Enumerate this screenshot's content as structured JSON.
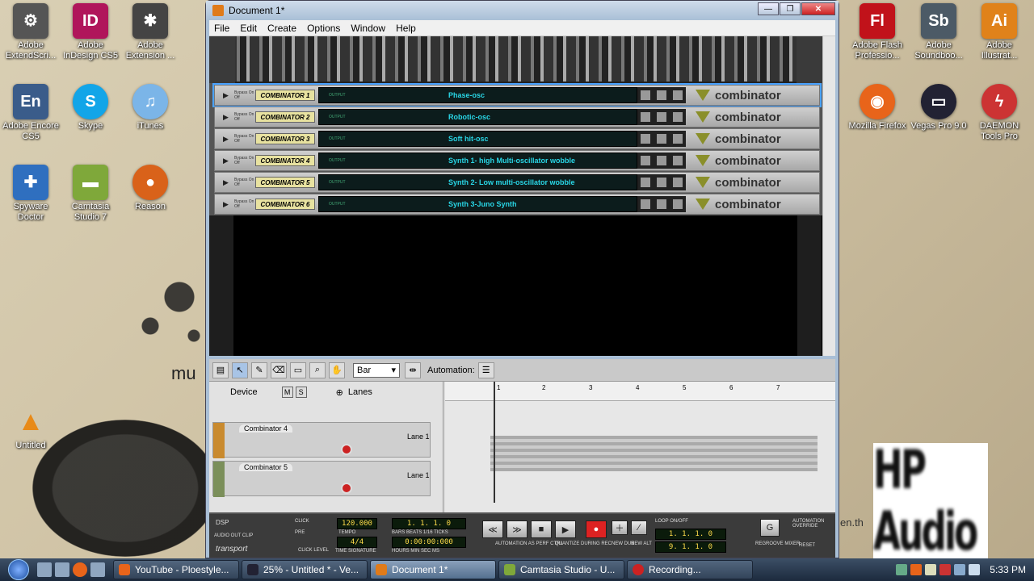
{
  "desktop": {
    "icons_left": [
      {
        "label": "Adobe ExtendScri...",
        "color": "#555"
      },
      {
        "label": "Adobe InDesign CS5",
        "color": "#b0155b",
        "glyph": "ID"
      },
      {
        "label": "Adobe Extension ...",
        "color": "#444"
      },
      {
        "label": "Adobe Encore CS5",
        "color": "#3a5c8a",
        "glyph": "En"
      },
      {
        "label": "Skype",
        "color": "#12a5e8",
        "glyph": "S"
      },
      {
        "label": "iTunes",
        "color": "#7bb5e8",
        "glyph": "♫"
      },
      {
        "label": "Spyware Doctor",
        "color": "#2f6fbf"
      },
      {
        "label": "Camtasia Studio 7",
        "color": "#7fa83a"
      },
      {
        "label": "Reason",
        "color": "#d9621a"
      },
      {
        "label": "Untitled",
        "color": "#e88a18",
        "glyph": "▲"
      }
    ],
    "icons_right": [
      {
        "label": "Adobe Flash Professio...",
        "color": "#c1121a",
        "glyph": "Fl"
      },
      {
        "label": "Adobe Soundboo...",
        "color": "#4c5a66",
        "glyph": "Sb"
      },
      {
        "label": "Adobe Illustrat...",
        "color": "#e0821a",
        "glyph": "Ai"
      },
      {
        "label": "Mozilla Firefox",
        "color": "#e8641a"
      },
      {
        "label": "Vegas Pro 9.0",
        "color": "#223"
      },
      {
        "label": "DAEMON Tools Pro",
        "color": "#c33"
      }
    ],
    "bg_text": "mu",
    "bg_text2": "en.th",
    "logo_text": "HP Audio"
  },
  "window": {
    "title": "Document 1*",
    "menu": [
      "File",
      "Edit",
      "Create",
      "Options",
      "Window",
      "Help"
    ]
  },
  "rack": {
    "combinators": [
      {
        "name": "COMBINATOR 1",
        "patch": "Phase-osc",
        "brand": "combinator"
      },
      {
        "name": "COMBINATOR 2",
        "patch": "Robotic-osc",
        "brand": "combinator"
      },
      {
        "name": "COMBINATOR 3",
        "patch": "Soft hit-osc",
        "brand": "combinator"
      },
      {
        "name": "COMBINATOR 4",
        "patch": "Synth 1- high Multi-oscillator wobble",
        "brand": "combinator"
      },
      {
        "name": "COMBINATOR 5",
        "patch": "Synth 2- Low multi-oscillator wobble",
        "brand": "combinator"
      },
      {
        "name": "COMBINATOR 6",
        "patch": "Synth 3-Juno Synth",
        "brand": "combinator"
      }
    ],
    "bypass_text": "Bypass On Off",
    "mini_text": "OUTPUT"
  },
  "sequencer": {
    "snap": "Bar",
    "automation_label": "Automation:",
    "col_device": "Device",
    "col_lanes": "Lanes",
    "m_label": "M",
    "s_label": "S",
    "tracks": [
      {
        "name": "Combinator 4",
        "lane": "Lane 1",
        "color": "#c98a2e"
      },
      {
        "name": "Combinator 5",
        "lane": "Lane 1",
        "color": "#7b8f5a"
      }
    ],
    "ruler": [
      "1",
      "2",
      "3",
      "4",
      "5",
      "6",
      "7"
    ]
  },
  "transport": {
    "dsp": "DSP",
    "audio_out_clip": "AUDIO OUT CLIP",
    "brand": "transport",
    "click": "CLICK",
    "pre": "PRE",
    "click_level": "CLICK LEVEL",
    "tempo": "120.000",
    "tempo_label": "TEMPO",
    "sig": "4/4",
    "sig_label": "TIME SIGNATURE",
    "position": "1. 1. 1. 0",
    "position_label": "BARS BEATS 1/16 TICKS",
    "time": "0:00:00:000",
    "time_label": "HOURS MIN SEC MS",
    "automation_perf": "AUTOMATION AS PERF CTRL",
    "quantize": "QUANTIZE DURING REC",
    "new_dub": "NEW DUB",
    "new_alt": "NEW ALT",
    "loop": "LOOP ON/OFF",
    "loop_l": "1. 1. 1. 0",
    "loop_r": "9. 1. 1. 0",
    "regroove": "REGROOVE MIXER",
    "override": "AUTOMATION OVERRIDE",
    "reset": "RESET"
  },
  "taskbar": {
    "tasks": [
      {
        "label": "YouTube - Ploestyle...",
        "color": "#e8641a"
      },
      {
        "label": "25% - Untitled * - Ve...",
        "color": "#223"
      },
      {
        "label": "Document 1*",
        "color": "#e07b1a",
        "active": true
      },
      {
        "label": "Camtasia Studio - U...",
        "color": "#7fa83a"
      },
      {
        "label": "Recording...",
        "color": "#c22"
      }
    ],
    "clock": "5:33 PM"
  }
}
